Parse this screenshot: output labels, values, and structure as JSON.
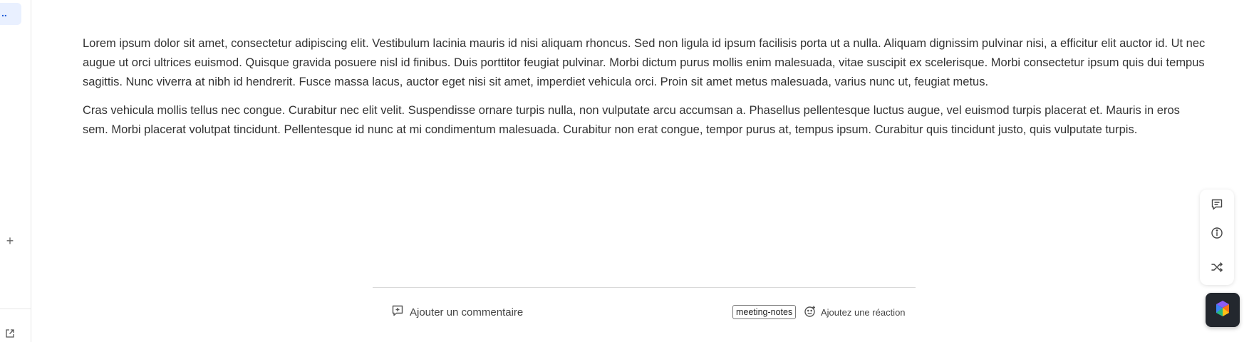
{
  "sidebar": {
    "active_item_label": "..",
    "add_label": "+",
    "icons": {
      "add": "plus-icon",
      "external": "external-link-icon"
    }
  },
  "document": {
    "paragraphs": [
      "Lorem ipsum dolor sit amet, consectetur adipiscing elit. Vestibulum lacinia mauris id nisi aliquam rhoncus. Sed non ligula id ipsum facilisis porta ut a nulla. Aliquam dignissim pulvinar nisi, a efficitur elit auctor id. Ut nec augue ut orci ultrices euismod. Quisque gravida posuere nisl id finibus. Duis porttitor feugiat pulvinar. Morbi dictum purus mollis enim malesuada, vitae suscipit ex scelerisque. Morbi consectetur ipsum quis dui tempus sagittis. Nunc viverra at nibh id hendrerit. Fusce massa lacus, auctor eget nisi sit amet, imperdiet vehicula orci. Proin sit amet metus malesuada, varius nunc ut, feugiat metus.",
      "Cras vehicula mollis tellus nec congue. Curabitur nec elit velit. Suspendisse ornare turpis nulla, non vulputate arcu accumsan a. Phasellus pellentesque luctus augue, vel euismod turpis placerat et. Mauris in eros sem. Morbi placerat volutpat tincidunt. Pellentesque id nunc at mi condimentum malesuada. Curabitur non erat congue, tempor purus at, tempus ipsum. Curabitur quis tincidunt justo, quis vulputate turpis."
    ]
  },
  "footer": {
    "add_comment_label": "Ajouter un commentaire",
    "tag": "meeting-notes",
    "add_reaction_label": "Ajoutez une réaction"
  },
  "right_toolbar": {
    "icons": [
      "comment-icon",
      "info-icon",
      "shuffle-icon"
    ]
  },
  "colors": {
    "accent": "#1e5bd8",
    "active_bg": "#e9f0ff",
    "launcher_bg": "#23272e"
  }
}
